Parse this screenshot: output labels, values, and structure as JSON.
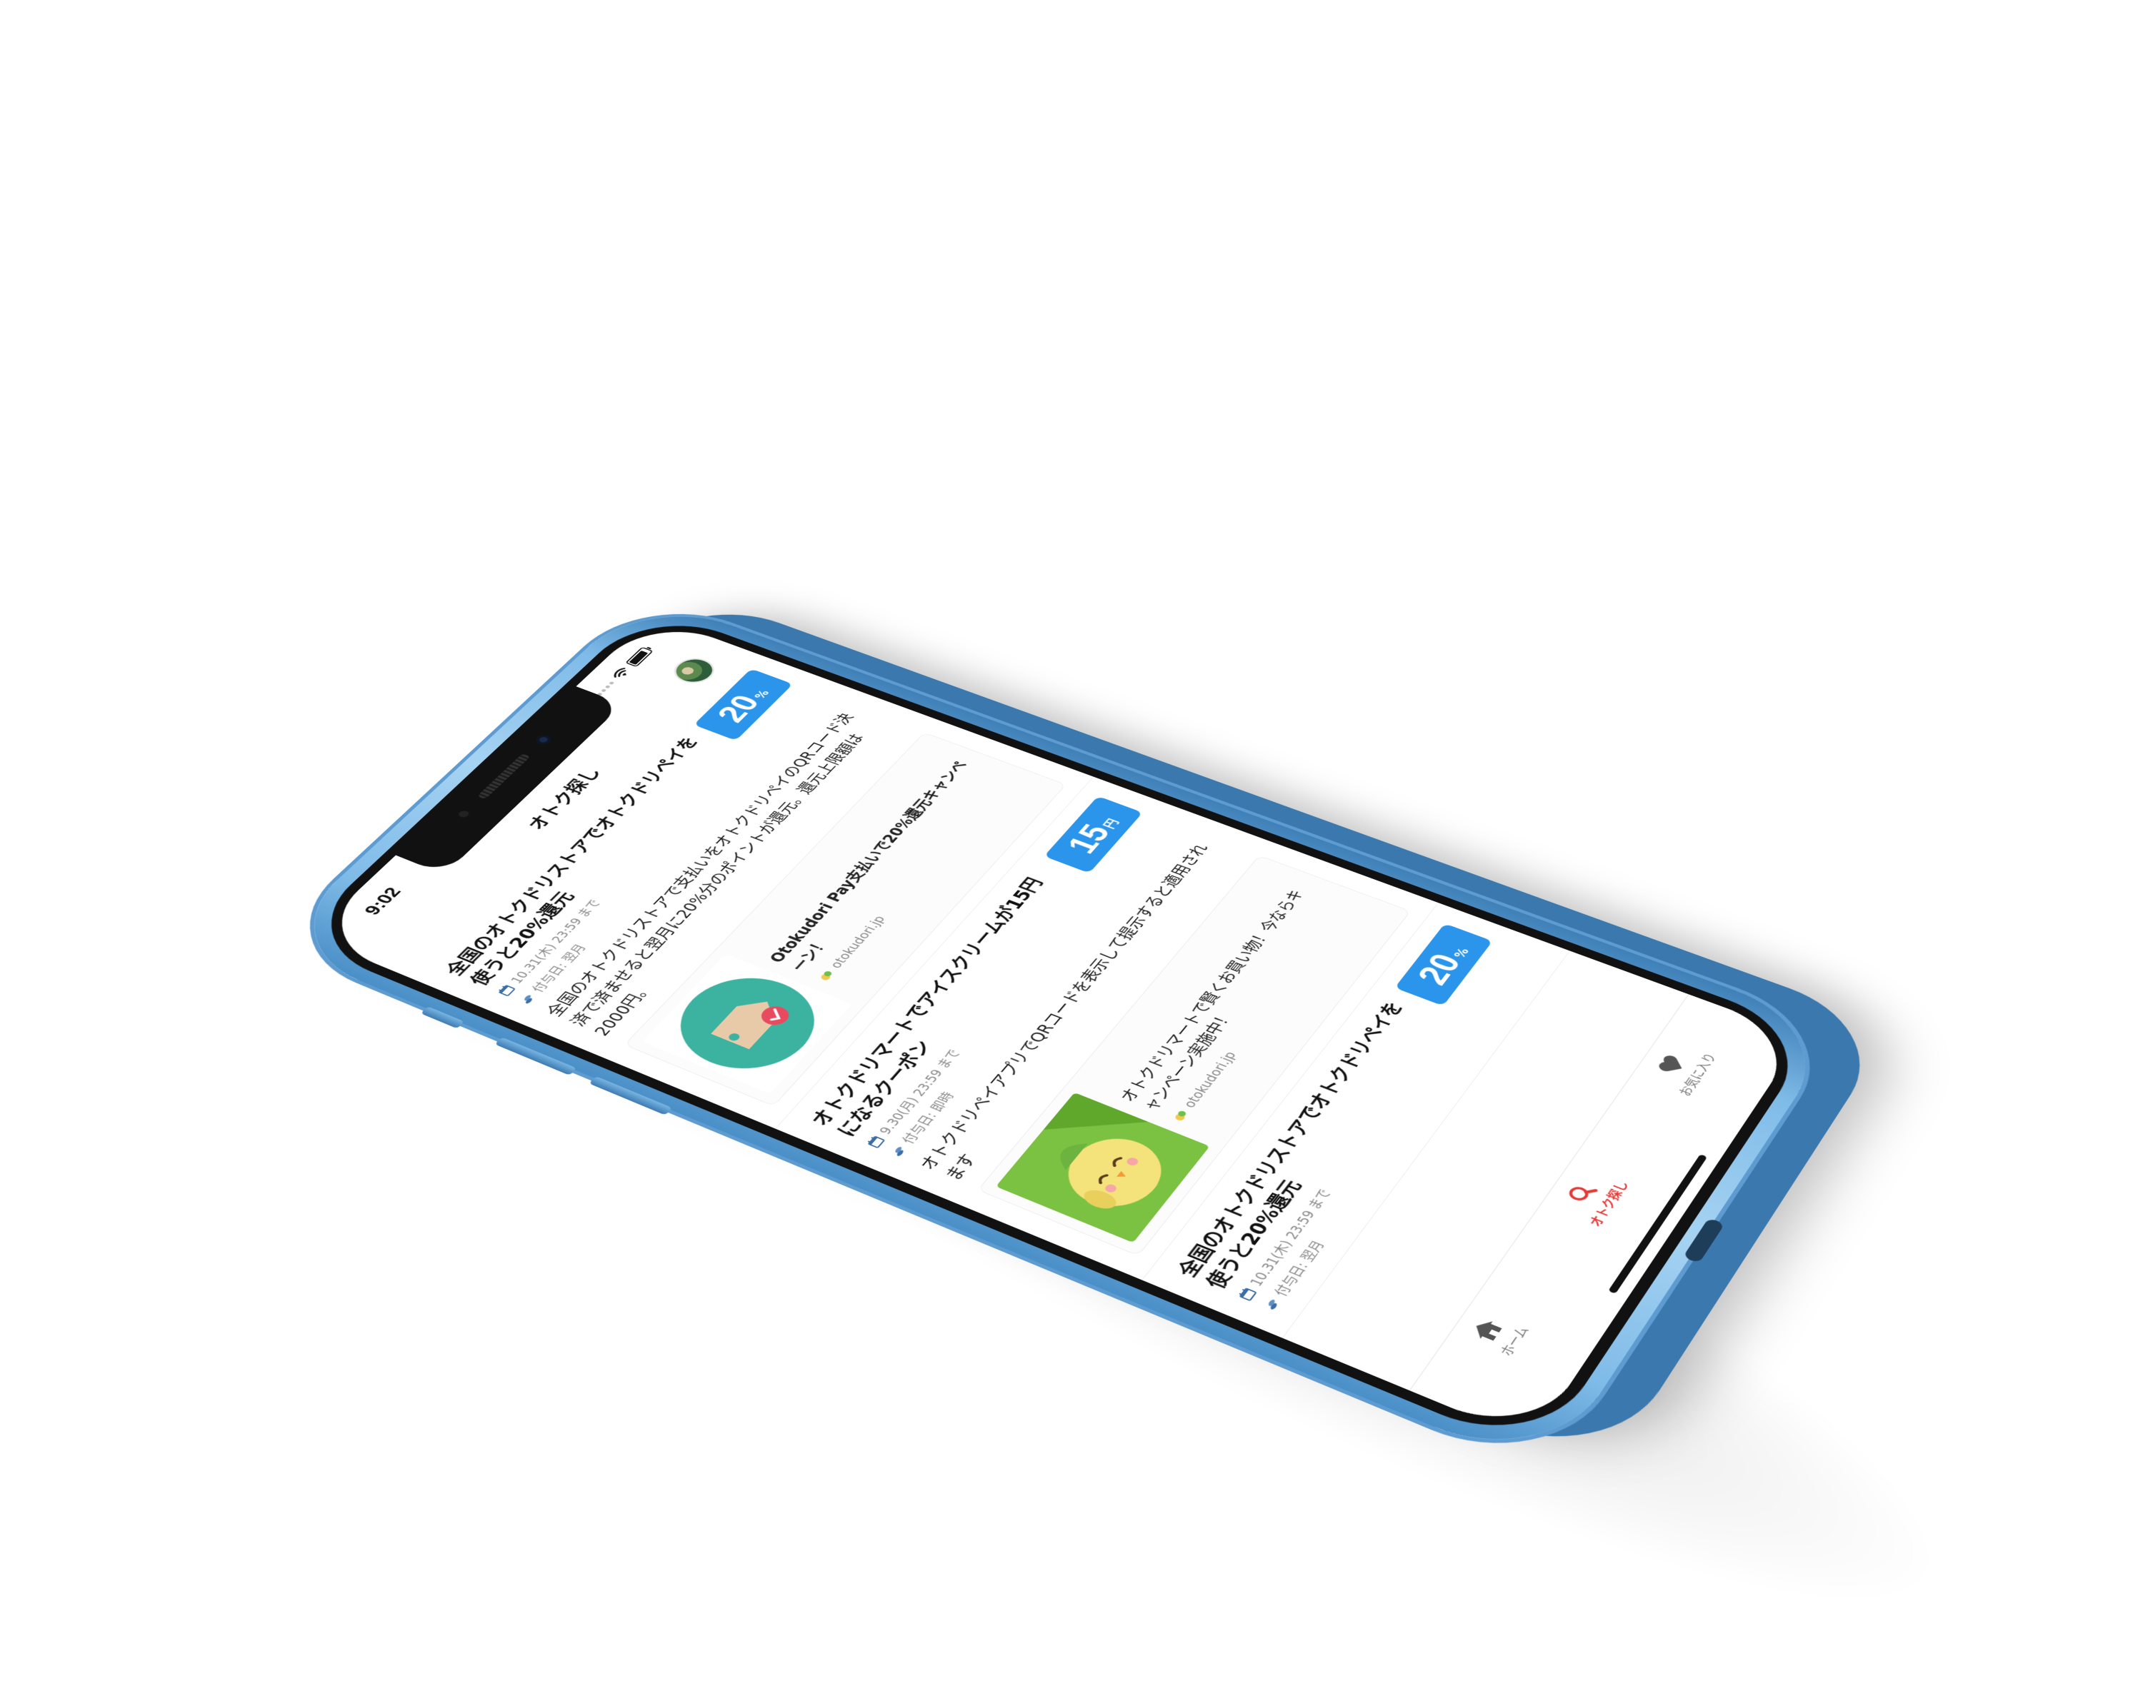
{
  "status_bar": {
    "time": "9:02",
    "battery_level": 0.9
  },
  "header": {
    "title": "オトク探し",
    "avatar_icon": "user-avatar"
  },
  "colors": {
    "badge_blue": "#2b95ec",
    "active_tab": "#e53935",
    "text": "#111111",
    "meta": "#8a8a8a",
    "frame_blue": "#7fbbe8"
  },
  "deals": [
    {
      "title": "全国のオトクドリストアでオトクドリペイを使うと20%還元",
      "rate_value": "20",
      "rate_unit": "%",
      "deadline": "10.31(木) 23:59 まで",
      "grant": "付与日: 翌月",
      "description": "全国のオトクドリストアで支払いをオトクドリペイのQRコード決済で済ませると翌月に20%分のポイントが還元。還元上限額は2000円。",
      "promo": {
        "thumb_icon": "price-tag-icon",
        "text": "Otokudori Pay支払いで20%還元キャンペーン！",
        "source": "otokudori.jp",
        "bold": true
      }
    },
    {
      "title": "オトクドリマートでアイスクリームが15円になるクーポン",
      "rate_value": "15",
      "rate_unit": "円",
      "deadline": "9.30(月) 23:59 まで",
      "grant": "付与日: 即時",
      "description": "オトクドリペイアプリでQRコードを表示して提示すると適用されます",
      "promo": {
        "thumb_icon": "bird-mascot-icon",
        "text": "オトクドリマートで賢くお買い物！今ならキャンペーン実施中！",
        "source": "otokudori.jp",
        "bold": false
      }
    },
    {
      "title": "全国のオトクドリストアでオトクドリペイを使うと20%還元",
      "rate_value": "20",
      "rate_unit": "%",
      "deadline": "10.31(木) 23:59 まで",
      "grant": "付与日: 翌月"
    }
  ],
  "tabs": [
    {
      "label": "ホーム",
      "icon": "home-icon",
      "active": false
    },
    {
      "label": "オトク探し",
      "icon": "search-icon",
      "active": true
    },
    {
      "label": "お気に入り",
      "icon": "heart-icon",
      "active": false
    }
  ]
}
